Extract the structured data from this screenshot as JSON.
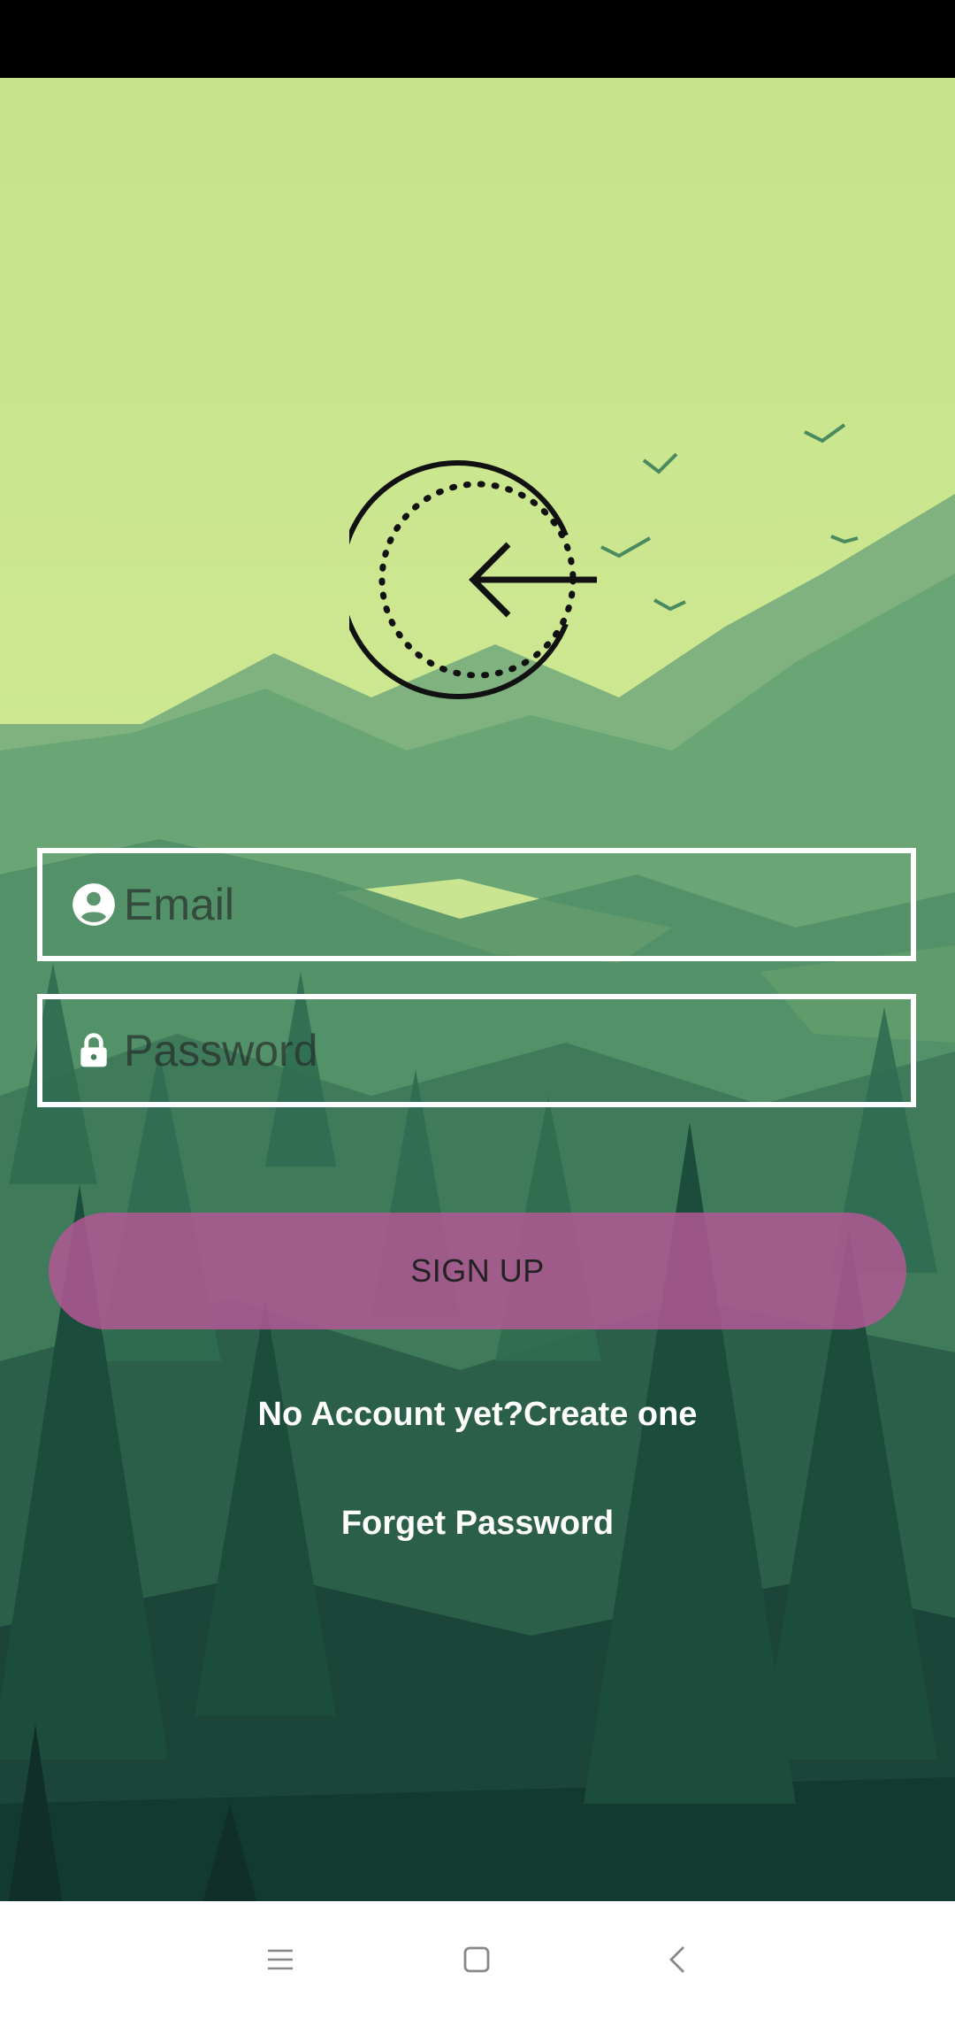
{
  "form": {
    "email_placeholder": "Email",
    "password_placeholder": "Password",
    "signup_label": "SIGN UP",
    "create_account_text": "No Account yet?Create one",
    "forget_password_text": "Forget Password"
  },
  "icons": {
    "logo": "back-arrow-circle-icon",
    "email": "account-circle-icon",
    "password": "lock-icon",
    "nav_menu": "menu-icon",
    "nav_home": "home-square-icon",
    "nav_back": "back-chevron-icon"
  },
  "colors": {
    "sky": "#c8e68c",
    "signup_button": "#b25894",
    "field_border": "#ffffff",
    "link_text": "#ffffff"
  }
}
